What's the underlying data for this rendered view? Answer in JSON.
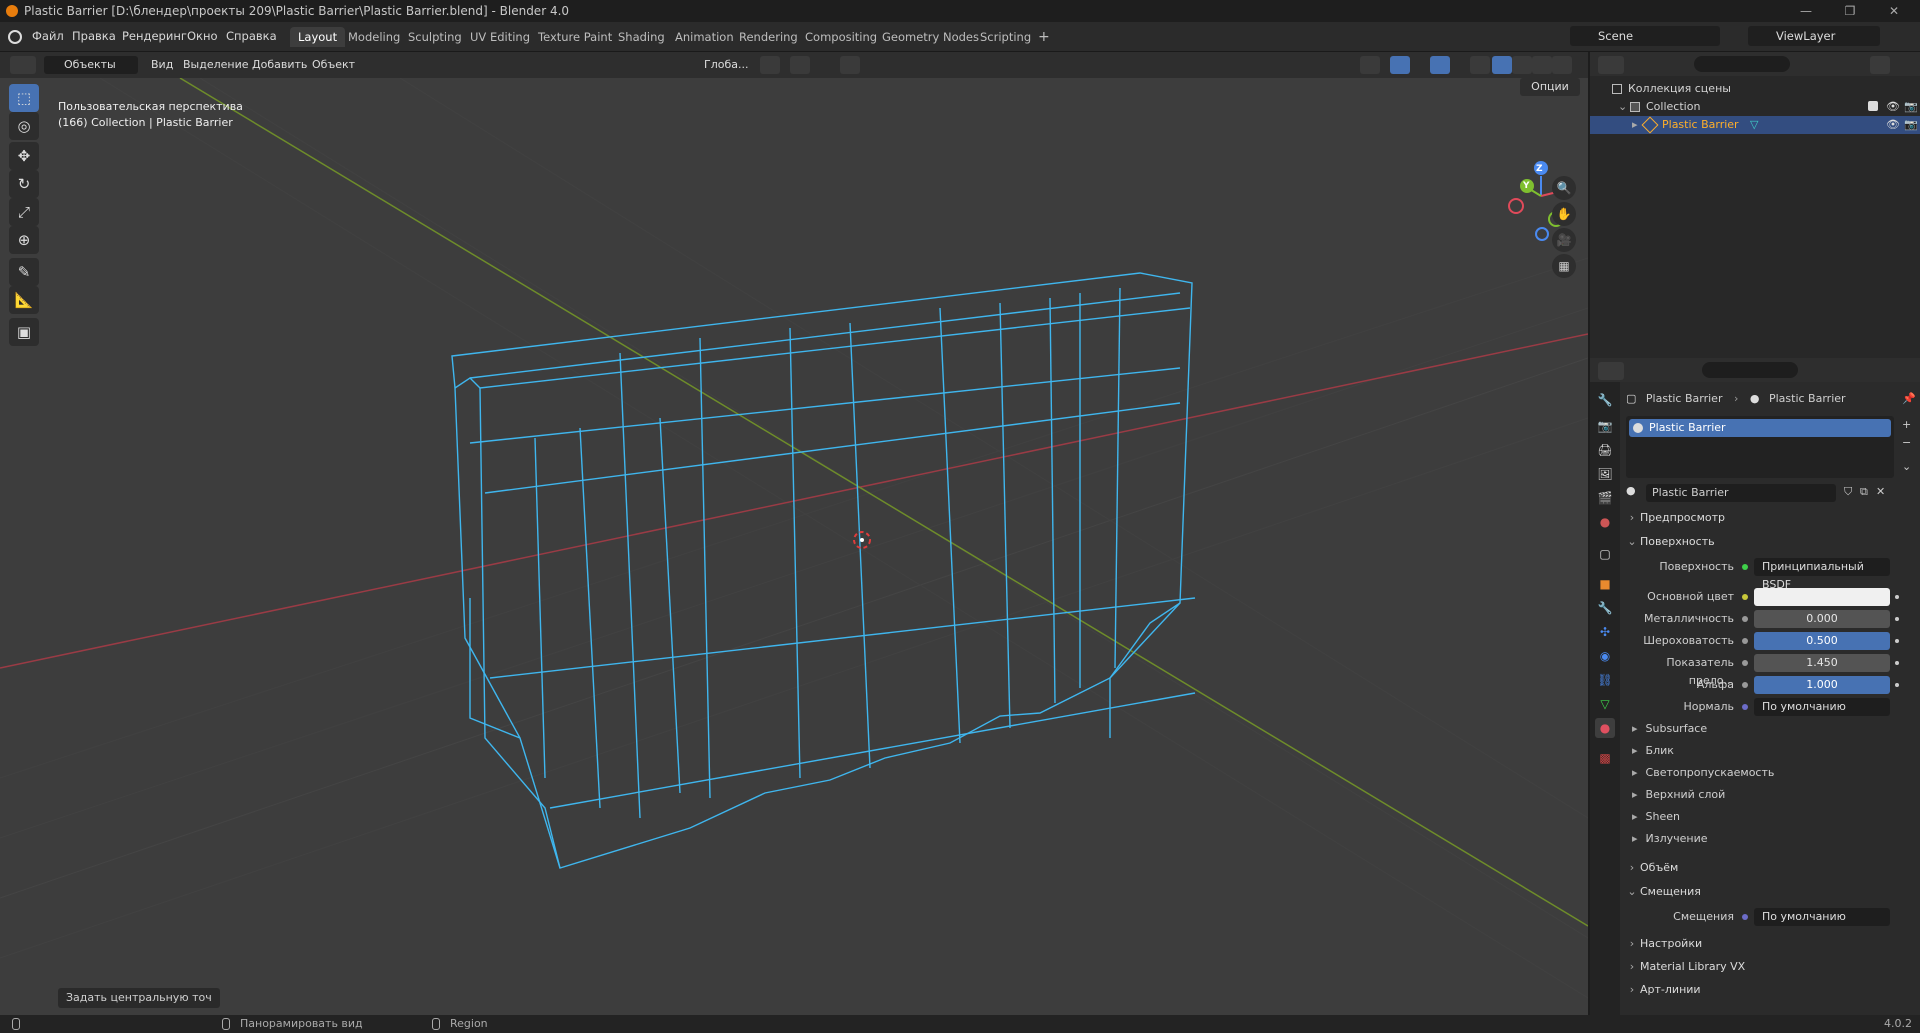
{
  "window": {
    "title": "Plastic Barrier [D:\\блендер\\проекты 209\\Plastic Barrier\\Plastic Barrier.blend] - Blender 4.0",
    "controls": [
      "—",
      "❐",
      "✕"
    ]
  },
  "menu": {
    "items": [
      "Файл",
      "Правка",
      "Рендеринг",
      "Окно",
      "Справка"
    ],
    "workspaces": [
      "Layout",
      "Modeling",
      "Sculpting",
      "UV Editing",
      "Texture Paint",
      "Shading",
      "Animation",
      "Rendering",
      "Compositing",
      "Geometry Nodes",
      "Scripting"
    ],
    "active_workspace": "Layout",
    "add_tab": "+",
    "scene": "Scene",
    "view_layer": "ViewLayer"
  },
  "viewport_header": {
    "mode": "Объекты",
    "items": [
      "Вид",
      "Выделение",
      "Добавить",
      "Объект"
    ],
    "transform_orientation": "Глоба...",
    "options": "Опции"
  },
  "viewport": {
    "perspective_label": "Пользовательская перспектива",
    "collection_label": "(166) Collection | Plastic Barrier",
    "last_operation": "Задать центральную точ",
    "gizmo_axes": [
      "X",
      "Y",
      "Z"
    ]
  },
  "outliner": {
    "root": "Коллекция сцены",
    "collection": "Collection",
    "object": "Plastic Barrier"
  },
  "properties": {
    "breadcrumb_object": "Plastic Barrier",
    "breadcrumb_material": "Plastic Barrier",
    "slot_name": "Plastic Barrier",
    "material_name": "Plastic Barrier",
    "panels": {
      "preview": "Предпросмотр",
      "surface": "Поверхность",
      "volume": "Объём",
      "displacement": "Смещения",
      "settings": "Настройки",
      "material_library": "Material Library VX",
      "line_art": "Арт-линии"
    },
    "surface": {
      "surface_label": "Поверхность",
      "surface_value": "Принципиальный BSDF",
      "base_color_label": "Основной цвет",
      "base_color": "#f0f0f0",
      "metallic_label": "Металличность",
      "metallic": "0.000",
      "roughness_label": "Шероховатость",
      "roughness": "0.500",
      "ior_label": "Показатель прело...",
      "ior": "1.450",
      "alpha_label": "Альфа",
      "alpha": "1.000",
      "normal_label": "Нормаль",
      "normal_value": "По умолчанию",
      "subpanels": [
        "Subsurface",
        "Блик",
        "Светопропускаемость",
        "Верхний слой",
        "Sheen",
        "Излучение"
      ]
    },
    "displacement": {
      "label": "Смещения",
      "value": "По умолчанию"
    }
  },
  "statusbar": {
    "hint_pan": "Панорамировать вид",
    "hint_region": "Region",
    "version": "4.0.2"
  },
  "colors": {
    "accent": "#4772b3",
    "wire": "#3fb6ee",
    "selected_text": "#ffaf29"
  }
}
